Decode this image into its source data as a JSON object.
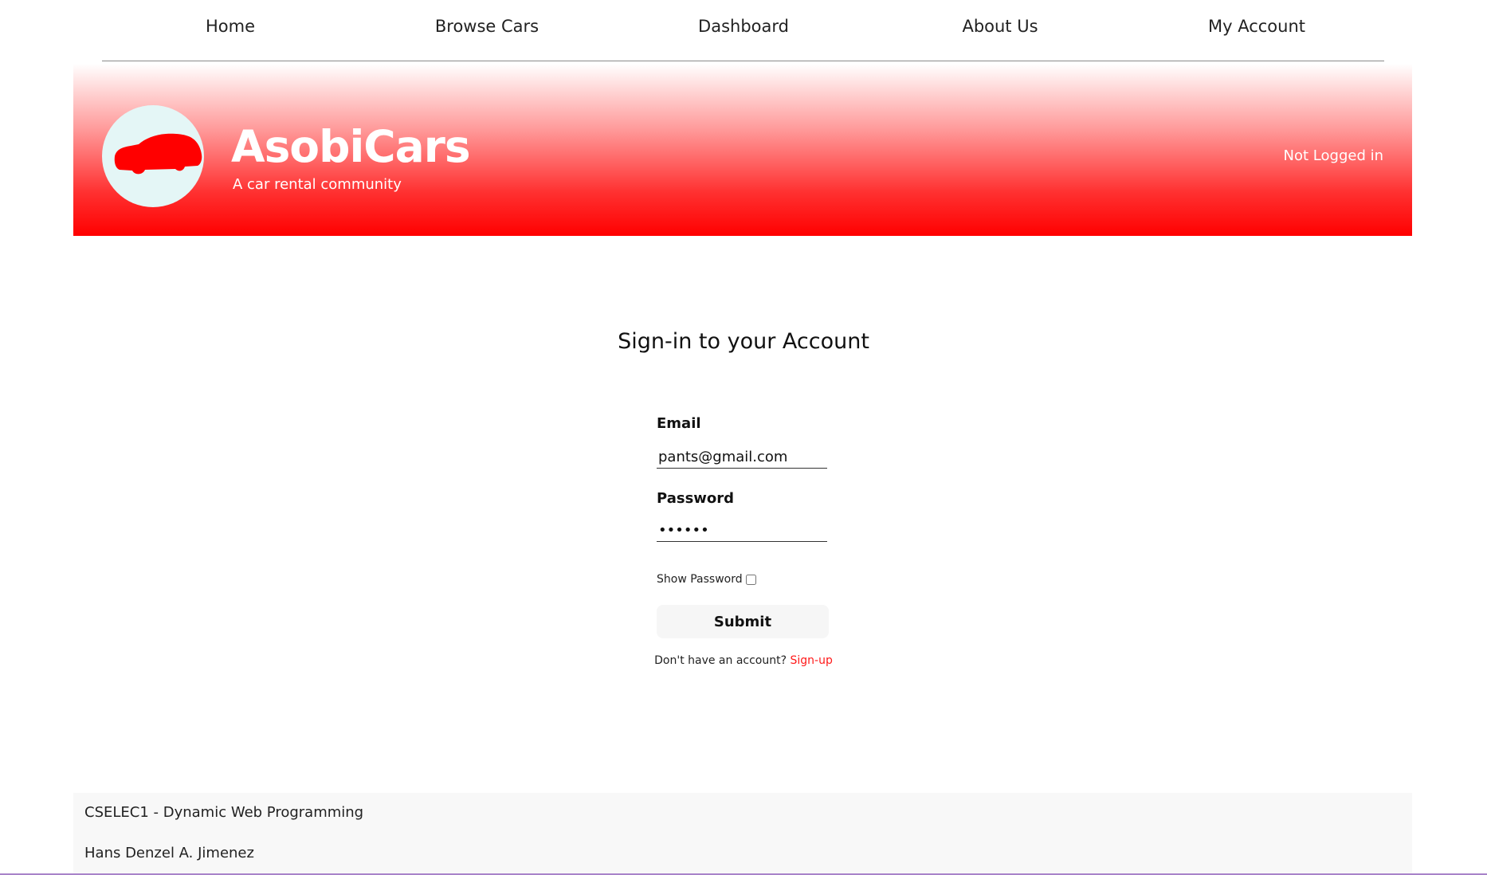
{
  "nav": {
    "items": [
      {
        "label": "Home"
      },
      {
        "label": "Browse Cars"
      },
      {
        "label": "Dashboard"
      },
      {
        "label": "About Us"
      },
      {
        "label": "My Account"
      }
    ]
  },
  "header": {
    "brand_name": "AsobiCars",
    "tagline": "A car rental community",
    "login_status": "Not Logged in",
    "logo_icon": "car-icon",
    "colors": {
      "banner_start": "#ffffff",
      "banner_end": "#ff0000",
      "logo_bg": "#e4f6f6",
      "car": "#ff0000"
    }
  },
  "form": {
    "title": "Sign-in to your Account",
    "email_label": "Email",
    "email_value": "pants@gmail.com",
    "password_label": "Password",
    "password_value": "123456",
    "show_password_label": "Show Password",
    "show_password_checked": false,
    "submit_label": "Submit",
    "signup_prompt": "Don't have an account?",
    "signup_link": "Sign-up",
    "link_color": "#ff1a1a"
  },
  "footer": {
    "course": "CSELEC1 - Dynamic Web Programming",
    "author": "Hans Denzel A. Jimenez"
  }
}
